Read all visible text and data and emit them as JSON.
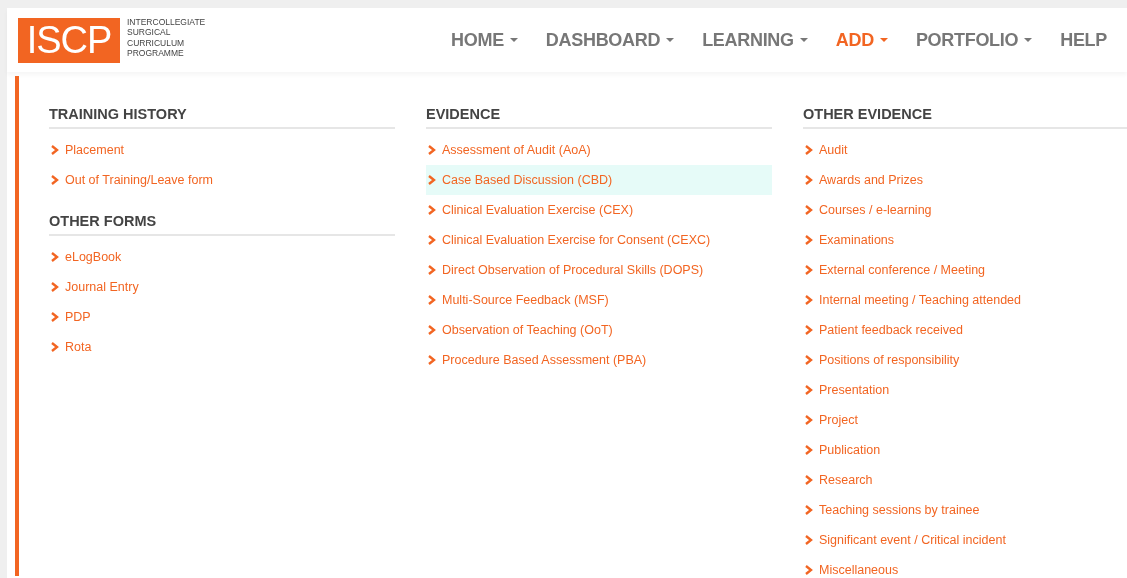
{
  "logo": {
    "mark": "ISCP",
    "lines": [
      "INTERCOLLEGIATE",
      "SURGICAL",
      "CURRICULUM",
      "PROGRAMME"
    ]
  },
  "nav": [
    {
      "label": "HOME",
      "dropdown": true,
      "selected": false
    },
    {
      "label": "DASHBOARD",
      "dropdown": true,
      "selected": false
    },
    {
      "label": "LEARNING",
      "dropdown": true,
      "selected": false
    },
    {
      "label": "ADD",
      "dropdown": true,
      "selected": true
    },
    {
      "label": "PORTFOLIO",
      "dropdown": true,
      "selected": false
    },
    {
      "label": "HELP",
      "dropdown": false,
      "selected": false
    }
  ],
  "menu": {
    "columns": [
      {
        "sections": [
          {
            "heading": "TRAINING HISTORY",
            "items": [
              {
                "label": "Placement",
                "selected": false
              },
              {
                "label": "Out of Training/Leave form",
                "selected": false
              }
            ]
          },
          {
            "heading": "OTHER FORMS",
            "items": [
              {
                "label": "eLogBook",
                "selected": false
              },
              {
                "label": "Journal Entry",
                "selected": false
              },
              {
                "label": "PDP",
                "selected": false
              },
              {
                "label": "Rota",
                "selected": false
              }
            ]
          }
        ]
      },
      {
        "sections": [
          {
            "heading": "EVIDENCE",
            "items": [
              {
                "label": "Assessment of Audit (AoA)",
                "selected": false
              },
              {
                "label": "Case Based Discussion (CBD)",
                "selected": true
              },
              {
                "label": "Clinical Evaluation Exercise (CEX)",
                "selected": false
              },
              {
                "label": "Clinical Evaluation Exercise for Consent (CEXC)",
                "selected": false
              },
              {
                "label": "Direct Observation of Procedural Skills (DOPS)",
                "selected": false
              },
              {
                "label": "Multi-Source Feedback (MSF)",
                "selected": false
              },
              {
                "label": "Observation of Teaching (OoT)",
                "selected": false
              },
              {
                "label": "Procedure Based Assessment (PBA)",
                "selected": false
              }
            ]
          }
        ]
      },
      {
        "sections": [
          {
            "heading": "OTHER EVIDENCE",
            "items": [
              {
                "label": "Audit",
                "selected": false
              },
              {
                "label": "Awards and Prizes",
                "selected": false
              },
              {
                "label": "Courses / e-learning",
                "selected": false
              },
              {
                "label": "Examinations",
                "selected": false
              },
              {
                "label": "External conference / Meeting",
                "selected": false
              },
              {
                "label": "Internal meeting / Teaching attended",
                "selected": false
              },
              {
                "label": "Patient feedback received",
                "selected": false
              },
              {
                "label": "Positions of responsibility",
                "selected": false
              },
              {
                "label": "Presentation",
                "selected": false
              },
              {
                "label": "Project",
                "selected": false
              },
              {
                "label": "Publication",
                "selected": false
              },
              {
                "label": "Research",
                "selected": false
              },
              {
                "label": "Teaching sessions by trainee",
                "selected": false
              },
              {
                "label": "Significant event / Critical incident",
                "selected": false
              },
              {
                "label": "Miscellaneous",
                "selected": false
              }
            ]
          }
        ]
      }
    ]
  }
}
